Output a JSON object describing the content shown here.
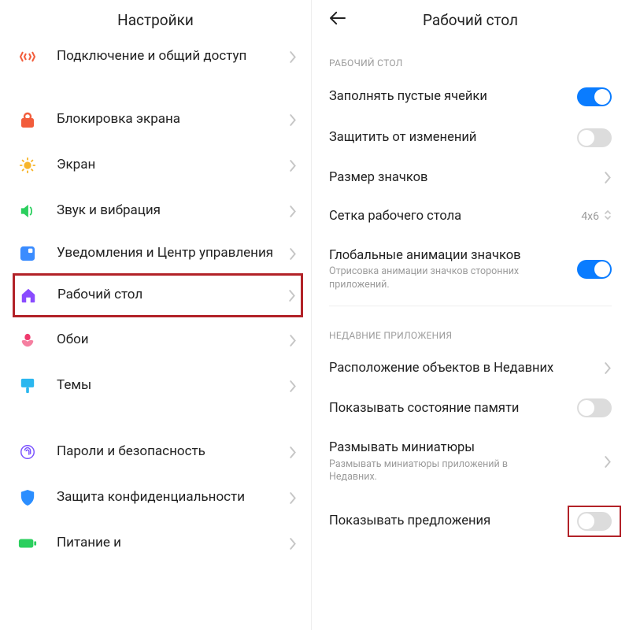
{
  "left": {
    "title": "Настройки",
    "items": {
      "connection": "Подключение и общий доступ",
      "lock": "Блокировка экрана",
      "display": "Экран",
      "sound": "Звук и вибрация",
      "notifications": "Уведомления и Центр управления",
      "home": "Рабочий стол",
      "wallpaper": "Обои",
      "themes": "Темы",
      "passwords": "Пароли и безопасность",
      "privacy": "Защита конфиденциальности",
      "battery": "Питание и"
    }
  },
  "right": {
    "title": "Рабочий стол",
    "section1": "РАБОЧИЙ СТОЛ",
    "fill_empty": "Заполнять пустые ячейки",
    "lock_layout": "Защитить от изменений",
    "icon_size": "Размер значков",
    "grid": "Сетка рабочего стола",
    "grid_value": "4x6",
    "global_anim": "Глобальные анимации значков",
    "global_anim_sub": "Отрисовка анимации значков сторонних приложений.",
    "section2": "НЕДАВНИЕ ПРИЛОЖЕНИЯ",
    "recents_layout": "Расположение объектов в Недавних",
    "memory": "Показывать состояние памяти",
    "blur": "Размывать миниатюры",
    "blur_sub": "Размывать миниатюры приложений в Недавних.",
    "suggestions": "Показывать предложения"
  }
}
